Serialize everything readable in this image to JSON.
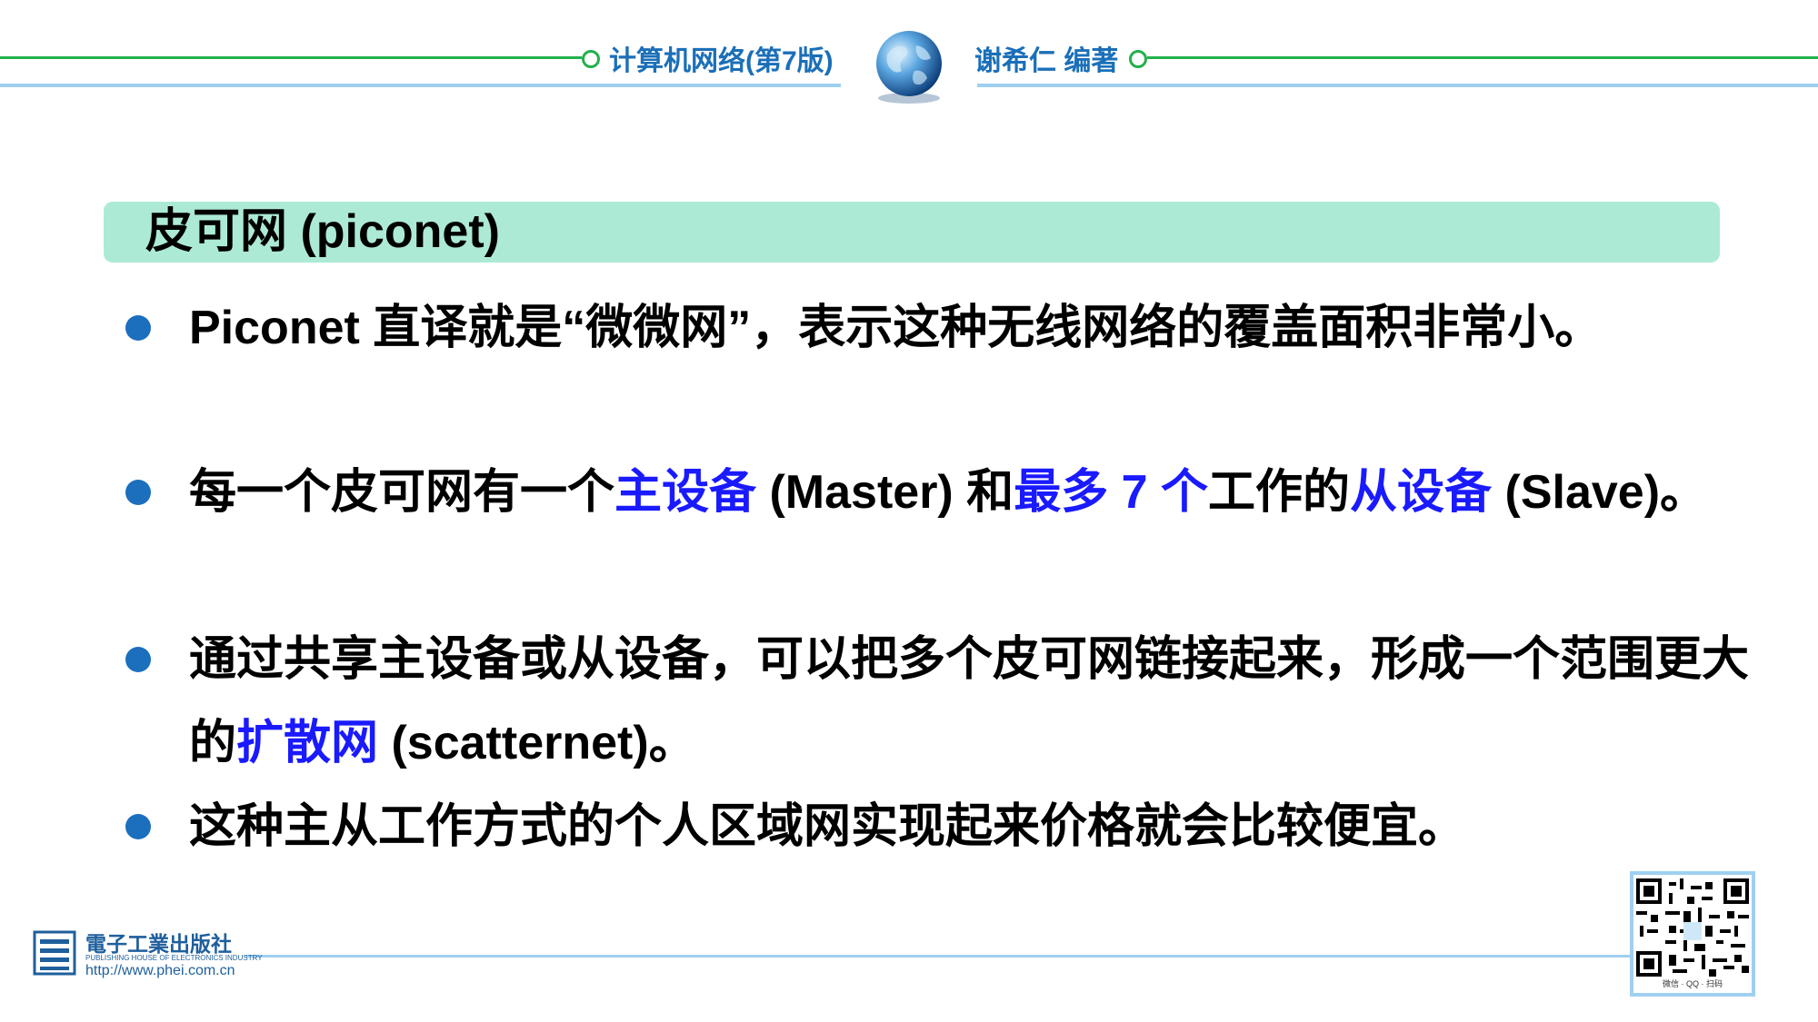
{
  "header": {
    "book_title": "计算机网络(第7版)",
    "book_author": "谢希仁 编著"
  },
  "title": "皮可网 (piconet)",
  "bullets": [
    {
      "parts": [
        {
          "text": "Piconet 直译就是“微微网”，表示这种无线网络的覆盖面积非常小。",
          "hl": false
        }
      ]
    },
    {
      "parts": [
        {
          "text": "每一个皮可网有一个",
          "hl": false
        },
        {
          "text": "主设备",
          "hl": true
        },
        {
          "text": " (Master) 和",
          "hl": false
        },
        {
          "text": "最多 7 个",
          "hl": true
        },
        {
          "text": "工作的",
          "hl": false
        },
        {
          "text": "从设备",
          "hl": true
        },
        {
          "text": " (Slave)。",
          "hl": false
        }
      ]
    },
    {
      "parts": [
        {
          "text": "通过共享主设备或从设备，可以把多个皮可网链接起来，形成一个范围更大的",
          "hl": false
        },
        {
          "text": "扩散网",
          "hl": true
        },
        {
          "text": " (scatternet)。",
          "hl": false
        }
      ]
    },
    {
      "parts": [
        {
          "text": "这种主从工作方式的个人区域网实现起来价格就会比较便宜。",
          "hl": false
        }
      ]
    }
  ],
  "footer": {
    "publisher_name": "電子工業出版社",
    "publisher_sub": "PUBLISHING HOUSE OF ELECTRONICS INDUSTRY",
    "publisher_url": "http://www.phei.com.cn",
    "qr_caption": "微信 · QQ · 扫码"
  },
  "colors": {
    "title_band": "#acead5",
    "highlight": "#1a1aff",
    "bullet_dot": "#1b6fbd",
    "header_text": "#1b6fb8",
    "header_green": "#22b14c",
    "header_blue": "#9fd0f0"
  }
}
